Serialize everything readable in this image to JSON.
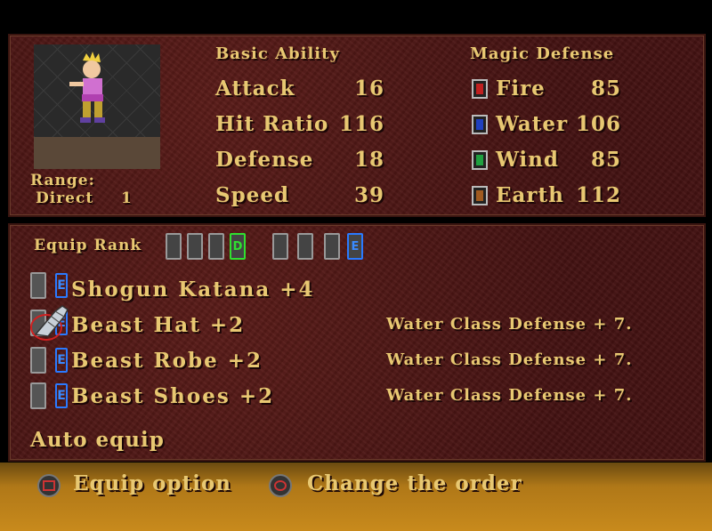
{
  "character": {
    "range_label": "Range:",
    "range_type": "Direct",
    "range_value": "1"
  },
  "basic_ability": {
    "title": "Basic Ability",
    "stats": [
      {
        "label": "Attack",
        "value": "16"
      },
      {
        "label": "Hit Ratio",
        "value": "116"
      },
      {
        "label": "Defense",
        "value": "18"
      },
      {
        "label": "Speed",
        "value": "39"
      }
    ]
  },
  "magic_defense": {
    "title": "Magic Defense",
    "elements": [
      {
        "label": "Fire",
        "value": "85",
        "icon": "fire-icon",
        "color": "#c02020"
      },
      {
        "label": "Water",
        "value": "106",
        "icon": "water-icon",
        "color": "#2040c0"
      },
      {
        "label": "Wind",
        "value": "85",
        "icon": "wind-icon",
        "color": "#20a040"
      },
      {
        "label": "Earth",
        "value": "112",
        "icon": "earth-icon",
        "color": "#a05a20"
      }
    ]
  },
  "equip": {
    "rank_label": "Equip Rank",
    "rank_badges": [
      "D",
      "E"
    ],
    "badge": "E",
    "items": [
      {
        "name": "Shogun  Katana  +4",
        "desc": ""
      },
      {
        "name": "Beast  Hat  +2",
        "desc": "Water  Class  Defense  +  7."
      },
      {
        "name": "Beast  Robe  +2",
        "desc": "Water  Class  Defense  +  7."
      },
      {
        "name": "Beast  Shoes  +2",
        "desc": "Water  Class  Defense  +  7."
      }
    ],
    "auto_equip": "Auto equip"
  },
  "footer": {
    "equip_option": "Equip option",
    "change_order": "Change the order"
  }
}
